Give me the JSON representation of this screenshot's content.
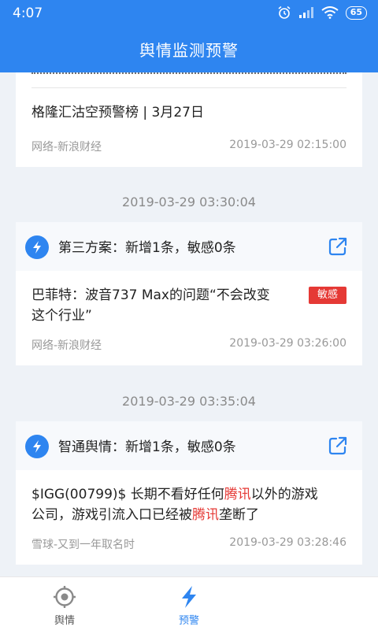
{
  "status_bar": {
    "time": "4:07",
    "battery": "65"
  },
  "header": {
    "title": "舆情监测预警"
  },
  "feed": {
    "partial_card": {
      "title": "格隆汇沽空预警榜 | 3月27日",
      "source": "网络-新浪财经",
      "time": "2019-03-29 02:15:00"
    },
    "groups": [
      {
        "timestamp": "2019-03-29 03:30:04",
        "scheme": "第三方案：新增1条，敏感0条",
        "item": {
          "title_line1": "巴菲特：波音737 Max的问题“不会改变",
          "title_line2": "这个行业”",
          "badge": "敏感",
          "source": "网络-新浪财经",
          "time": "2019-03-29 03:26:00"
        }
      },
      {
        "timestamp": "2019-03-29 03:35:04",
        "scheme": "智通舆情：新增1条，敏感0条",
        "item": {
          "l1_a": "$IGG(00799)$ 长期不看好任何",
          "l1_hl": "腾讯",
          "l1_b": "以外的游戏",
          "l2_a": "公司，游戏引流入口已经被",
          "l2_hl": "腾讯",
          "l2_b": "垄断了",
          "source": "雪球-又到一年取名时",
          "time": "2019-03-29 03:28:46"
        }
      }
    ]
  },
  "bottom_nav": {
    "items": [
      {
        "label": "舆情",
        "icon": "target-icon",
        "active": false
      },
      {
        "label": "预警",
        "icon": "lightning-icon",
        "active": true
      }
    ]
  },
  "colors": {
    "primary": "#2e85f0",
    "alert_red": "#e53935",
    "background": "#eef2f7"
  }
}
